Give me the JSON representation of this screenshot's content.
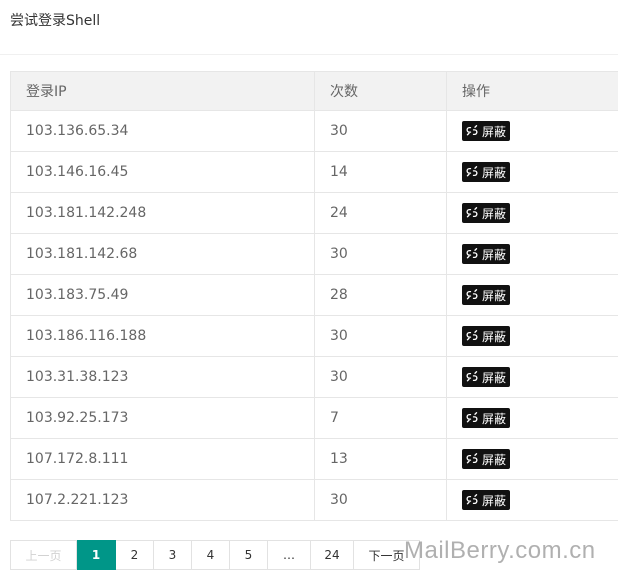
{
  "page": {
    "title": "尝试登录Shell"
  },
  "table": {
    "headers": [
      "登录IP",
      "次数",
      "操作"
    ],
    "rows": [
      {
        "ip": "103.136.65.34",
        "count": "30",
        "action": "屏蔽"
      },
      {
        "ip": "103.146.16.45",
        "count": "14",
        "action": "屏蔽"
      },
      {
        "ip": "103.181.142.248",
        "count": "24",
        "action": "屏蔽"
      },
      {
        "ip": "103.181.142.68",
        "count": "30",
        "action": "屏蔽"
      },
      {
        "ip": "103.183.75.49",
        "count": "28",
        "action": "屏蔽"
      },
      {
        "ip": "103.186.116.188",
        "count": "30",
        "action": "屏蔽"
      },
      {
        "ip": "103.31.38.123",
        "count": "30",
        "action": "屏蔽"
      },
      {
        "ip": "103.92.25.173",
        "count": "7",
        "action": "屏蔽"
      },
      {
        "ip": "107.172.8.111",
        "count": "13",
        "action": "屏蔽"
      },
      {
        "ip": "107.2.221.123",
        "count": "30",
        "action": "屏蔽"
      }
    ],
    "action_icon": "unlink-icon"
  },
  "pagination": {
    "prev_label": "上一页",
    "pages": [
      "1",
      "2",
      "3",
      "4",
      "5",
      "…",
      "24"
    ],
    "current": "1",
    "next_label": "下一页"
  },
  "watermark": "MailBerry.com.cn",
  "colors": {
    "accent": "#009688",
    "button_bg": "#111111",
    "header_bg": "#f2f2f2"
  }
}
